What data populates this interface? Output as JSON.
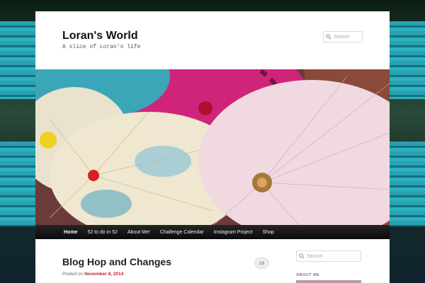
{
  "site": {
    "title": "Loran's World",
    "description": "A slice of Loran's life"
  },
  "header_search": {
    "placeholder": "Search"
  },
  "nav": {
    "items": [
      {
        "label": "Home",
        "active": true
      },
      {
        "label": "52 to do in 52"
      },
      {
        "label": "About Me!"
      },
      {
        "label": "Challenge Calendar"
      },
      {
        "label": "Instagram Project"
      },
      {
        "label": "Shop"
      }
    ]
  },
  "post": {
    "title": "Blog Hop and Changes",
    "posted_on": "Posted on",
    "date": "November 8, 2014",
    "comment_count": "16"
  },
  "sidebar": {
    "search_placeholder": "Search",
    "widget_title": "ABOUT ME"
  },
  "colors": {
    "accent": "#b8232f",
    "nav_bg": "#1a1a1a"
  }
}
